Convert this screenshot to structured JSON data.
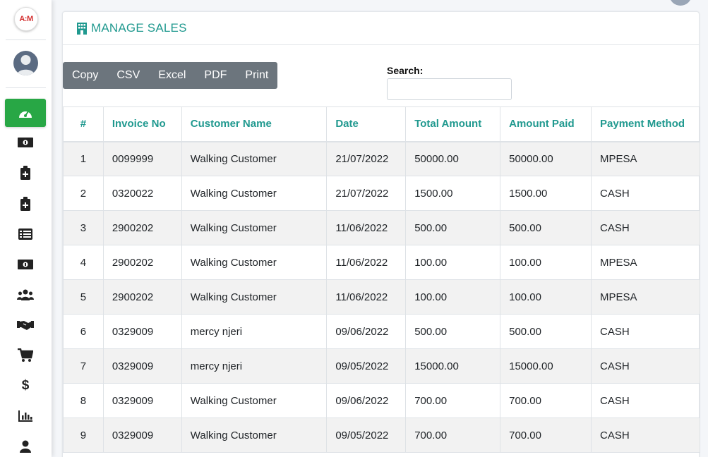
{
  "logo": {
    "text": "A:M"
  },
  "header": {
    "title": "MANAGE SALES"
  },
  "toolbar": {
    "copy": "Copy",
    "csv": "CSV",
    "excel": "Excel",
    "pdf": "PDF",
    "print": "Print"
  },
  "search": {
    "label": "Search:",
    "value": ""
  },
  "table": {
    "columns": [
      "#",
      "Invoice No",
      "Customer Name",
      "Date",
      "Total Amount",
      "Amount Paid",
      "Payment Method"
    ],
    "rows": [
      [
        "1",
        "0099999",
        "Walking Customer",
        "21/07/2022",
        "50000.00",
        "50000.00",
        "MPESA"
      ],
      [
        "2",
        "0320022",
        "Walking Customer",
        "21/07/2022",
        "1500.00",
        "1500.00",
        "CASH"
      ],
      [
        "3",
        "2900202",
        "Walking Customer",
        "11/06/2022",
        "500.00",
        "500.00",
        "CASH"
      ],
      [
        "4",
        "2900202",
        "Walking Customer",
        "11/06/2022",
        "100.00",
        "100.00",
        "MPESA"
      ],
      [
        "5",
        "2900202",
        "Walking Customer",
        "11/06/2022",
        "100.00",
        "100.00",
        "MPESA"
      ],
      [
        "6",
        "0329009",
        "mercy njeri",
        "09/06/2022",
        "500.00",
        "500.00",
        "CASH"
      ],
      [
        "7",
        "0329009",
        "mercy njeri",
        "09/05/2022",
        "15000.00",
        "15000.00",
        "CASH"
      ],
      [
        "8",
        "0329009",
        "Walking Customer",
        "09/06/2022",
        "700.00",
        "700.00",
        "CASH"
      ],
      [
        "9",
        "0329009",
        "Walking Customer",
        "09/05/2022",
        "700.00",
        "700.00",
        "CASH"
      ]
    ]
  },
  "sidebar": {
    "icons": [
      "dashboard-icon",
      "money-bill-icon",
      "clipboard-add-icon",
      "clipboard-add-icon",
      "list-icon",
      "money-bill-icon",
      "users-icon",
      "handshake-icon",
      "cart-icon",
      "dollar-icon",
      "chart-icon",
      "user-icon"
    ]
  },
  "colors": {
    "accent": "#20998f",
    "active": "#28a745",
    "toolbar": "#6c757d"
  }
}
